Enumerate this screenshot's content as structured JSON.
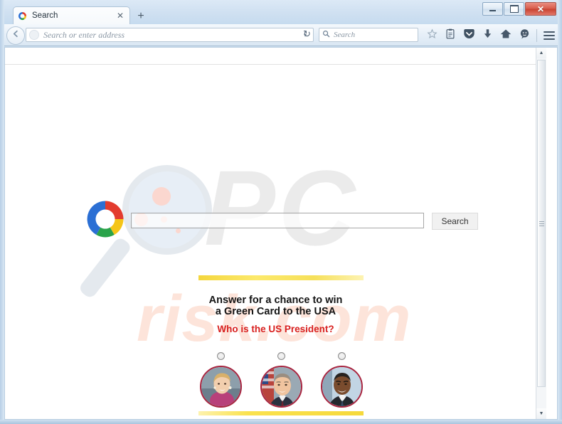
{
  "window": {
    "controls": {
      "minimize_label": "–",
      "maximize_label": "□",
      "close_label": "✕"
    }
  },
  "browser": {
    "tab": {
      "title": "Search",
      "favicon": "colored-ring-logo-icon",
      "close_label": "✕"
    },
    "new_tab_label": "+",
    "back_icon": "back-arrow-icon",
    "address_bar": {
      "value": "",
      "placeholder": "Search or enter address",
      "dropdown_marker": "▾",
      "reload_label": "↻",
      "identity_icon": "site-identity-icon"
    },
    "search_bar": {
      "value": "",
      "placeholder": "Search",
      "icon": "magnifier-icon"
    },
    "toolbar_icons": [
      {
        "name": "bookmark-star-icon",
        "glyph": "☆"
      },
      {
        "name": "reader-clipboard-icon",
        "glyph": "὜9"
      },
      {
        "name": "pocket-shield-icon",
        "glyph": "▼"
      },
      {
        "name": "downloads-arrow-icon",
        "glyph": "⬇"
      },
      {
        "name": "home-icon",
        "glyph": "⌂"
      },
      {
        "name": "sync-chat-icon",
        "glyph": "●"
      },
      {
        "name": "menu-hamburger-icon",
        "glyph": "☰"
      }
    ]
  },
  "page": {
    "logo_icon": "colored-ring-logo-icon",
    "search": {
      "input_value": "",
      "input_placeholder": "",
      "button_label": "Search"
    },
    "promo": {
      "headline_line1": "Answer for a chance to win",
      "headline_line2": "a Green Card to the USA",
      "question": "Who is the US President?"
    },
    "answers": [
      {
        "radio_name": "answer-radio-1",
        "photo_name": "portrait-hillary-clinton",
        "selected": false
      },
      {
        "radio_name": "answer-radio-2",
        "photo_name": "portrait-george-w-bush",
        "selected": false
      },
      {
        "radio_name": "answer-radio-3",
        "photo_name": "portrait-barack-obama",
        "selected": false
      }
    ],
    "watermark": {
      "text_main": "PC",
      "text_sub": "risk.com"
    }
  },
  "colors": {
    "question_red": "#d8201f",
    "divider_yellow": "#f6d93b",
    "portrait_ring": "#a8243f",
    "watermark_gray": "#ebebeb",
    "watermark_salmon": "#fde4da",
    "close_button_red": "#c94433"
  },
  "scrollbar": {
    "up_label": "▲",
    "down_label": "▼"
  }
}
